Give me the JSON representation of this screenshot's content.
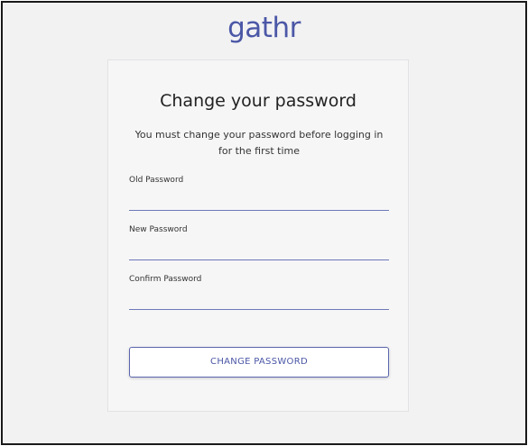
{
  "brand": {
    "logo_text": "gathr",
    "accent_color": "#4b57a6"
  },
  "form": {
    "title": "Change your password",
    "subtitle": "You must change your password before logging in for the first time",
    "fields": [
      {
        "label": "Old Password",
        "value": ""
      },
      {
        "label": "New Password",
        "value": ""
      },
      {
        "label": "Confirm Password",
        "value": ""
      }
    ],
    "submit_label": "CHANGE PASSWORD"
  }
}
